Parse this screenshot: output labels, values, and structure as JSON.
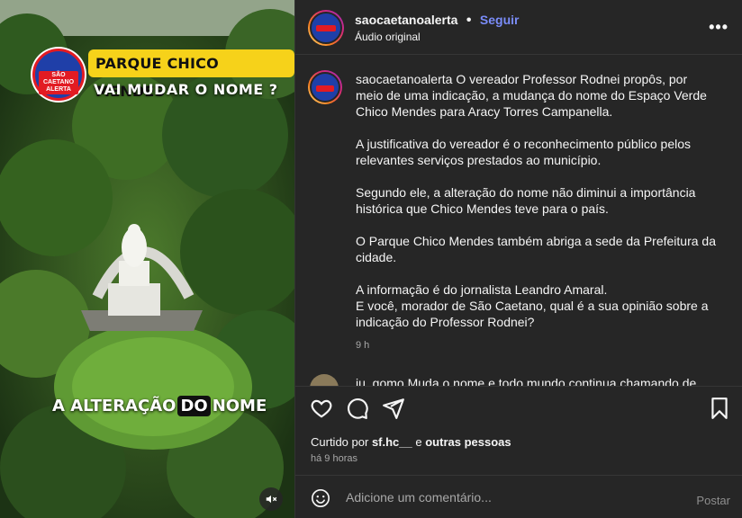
{
  "media": {
    "logo_text": "SÃO CAETANO ALERTA",
    "banner_title": "PARQUE CHICO MENDES",
    "banner_subtitle": "VAI MUDAR O NOME ?",
    "overlay_caption": {
      "part1": "A ALTERAÇÃO",
      "highlight": "DO",
      "part2": "NOME"
    },
    "mute_icon": "speaker-muted-icon"
  },
  "header": {
    "username": "saocaetanoalerta",
    "separator": "•",
    "follow_label": "Seguir",
    "audio_label": "Áudio original",
    "more_icon": "more-horizontal-icon"
  },
  "caption": {
    "username": "saocaetanoalerta",
    "paragraphs": [
      "O vereador Professor Rodnei propôs, por meio de uma indicação, a mudança do nome do Espaço Verde Chico Mendes para Aracy Torres Campanella.",
      "A justificativa do vereador é o reconhecimento público pelos relevantes serviços prestados ao município.",
      "Segundo ele, a alteração do nome não diminui a importância histórica que Chico Mendes teve para o país.",
      "O Parque Chico Mendes também abriga a sede da Prefeitura da cidade."
    ],
    "last_lines": [
      "A informação é do jornalista Leandro Amaral.",
      "E você, morador de São Caetano, qual é a sua opinião sobre a indicação do Professor Rodnei?"
    ],
    "time_ago": "9 h"
  },
  "second_comment": {
    "text": "iu_gomo Muda o nome e todo mundo continua chamando de"
  },
  "actions": {
    "icons": [
      "heart-icon",
      "comment-icon",
      "share-icon",
      "bookmark-icon"
    ],
    "liked_by_prefix": "Curtido por",
    "liked_by_user": "sf.hc__",
    "liked_by_join": "e",
    "liked_by_others": "outras pessoas",
    "posted_ago": "há 9 horas"
  },
  "composer": {
    "placeholder": "Adicione um comentário...",
    "post_label": "Postar"
  },
  "colors": {
    "panel_bg": "#262626",
    "follow": "#7a8cf8",
    "banner_yellow": "#f6d21a",
    "muted_text": "#a8a8a8"
  }
}
